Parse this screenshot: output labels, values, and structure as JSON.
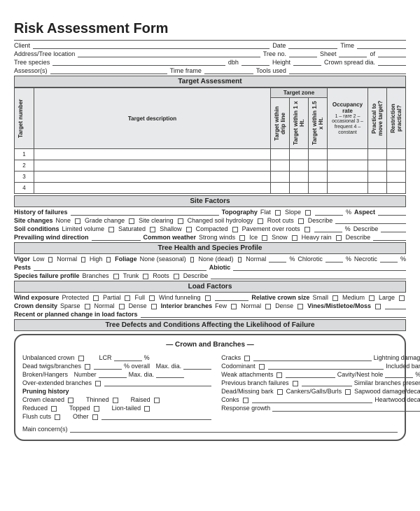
{
  "title": "Risk Assessment Form",
  "header": {
    "client": "Client",
    "date": "Date",
    "time": "Time",
    "address": "Address/Tree location",
    "treeNo": "Tree no.",
    "sheet": "Sheet",
    "of": "of",
    "species": "Tree species",
    "dbh": "dbh",
    "height": "Height",
    "spread": "Crown spread dia.",
    "assessor": "Assessor(s)",
    "timeframe": "Time frame",
    "tools": "Tools used"
  },
  "sections": {
    "target": "Target Assessment",
    "site": "Site Factors",
    "health": "Tree Health and Species Profile",
    "load": "Load Factors",
    "defects": "Tree Defects and Conditions Affecting the Likelihood of Failure",
    "crown": "— Crown and Branches —"
  },
  "targetTable": {
    "colTargetNum": "Target number",
    "colDesc": "Target description",
    "groupZone": "Target zone",
    "zone1": "Target within drip line",
    "zone2": "Target within 1 x Ht.",
    "zone3": "Target within 1.5 x Ht.",
    "occHead": "Occupancy rate",
    "occDetail": "1 – rare\n2 – occasional\n3 – frequent\n4 – constant",
    "practical": "Practical to move target?",
    "restrict": "Restriction practical?",
    "rows": [
      "1",
      "2",
      "3",
      "4"
    ]
  },
  "site": {
    "histFail": "History of failures",
    "topo": "Topography",
    "flat": "Flat",
    "slope": "Slope",
    "pct": "%",
    "aspect": "Aspect",
    "siteChanges": "Site changes",
    "none": "None",
    "grade": "Grade change",
    "clearing": "Site clearing",
    "hydro": "Changed soil hydrology",
    "rootcuts": "Root cuts",
    "describe": "Describe",
    "soil": "Soil conditions",
    "limvol": "Limited volume",
    "sat": "Saturated",
    "shallow": "Shallow",
    "compact": "Compacted",
    "pave": "Pavement over roots",
    "wind": "Prevailing wind direction",
    "weather": "Common weather",
    "strong": "Strong winds",
    "ice": "Ice",
    "snow": "Snow",
    "heavy": "Heavy rain"
  },
  "health": {
    "vigor": "Vigor",
    "low": "Low",
    "normal": "Normal",
    "high": "High",
    "foliage": "Foliage",
    "noneSeason": "None (seasonal)",
    "noneDead": "None (dead)",
    "chlorotic": "Chlorotic",
    "necrotic": "Necrotic",
    "pests": "Pests",
    "abiotic": "Abiotic",
    "speciesFail": "Species failure profile",
    "branches": "Branches",
    "trunk": "Trunk",
    "roots": "Roots"
  },
  "load": {
    "windExp": "Wind exposure",
    "protected": "Protected",
    "partial": "Partial",
    "full": "Full",
    "funnel": "Wind funneling",
    "relCrown": "Relative crown size",
    "small": "Small",
    "medium": "Medium",
    "large": "Large",
    "crownDen": "Crown density",
    "sparse": "Sparse",
    "dense": "Dense",
    "interior": "Interior branches",
    "few": "Few",
    "vines": "Vines/Mistletoe/Moss",
    "recent": "Recent or planned change in load factors"
  },
  "crown": {
    "unbal": "Unbalanced crown",
    "lcr": "LCR",
    "deadTwigs": "Dead twigs/branches",
    "overall": "% overall",
    "maxDia": "Max. dia.",
    "broken": "Broken/Hangers",
    "number": "Number",
    "overext": "Over-extended branches",
    "pruneHist": "Pruning history",
    "crownClean": "Crown cleaned",
    "thinned": "Thinned",
    "raised": "Raised",
    "reduced": "Reduced",
    "topped": "Topped",
    "lion": "Lion-tailed",
    "flush": "Flush cuts",
    "other": "Other",
    "cracks": "Cracks",
    "lightning": "Lightning damage",
    "codom": "Codominant",
    "incbark": "Included bark",
    "weak": "Weak attachments",
    "cavity": "Cavity/Nest hole",
    "circ": "% circ.",
    "prevFail": "Previous branch failures",
    "similar": "Similar branches present",
    "deadMiss": "Dead/Missing bark",
    "cankers": "Cankers/Galls/Burls",
    "sapwood": "Sapwood damage/decay",
    "conks": "Conks",
    "heartwood": "Heartwood decay",
    "response": "Response growth",
    "mainConcern": "Main concern(s)"
  }
}
